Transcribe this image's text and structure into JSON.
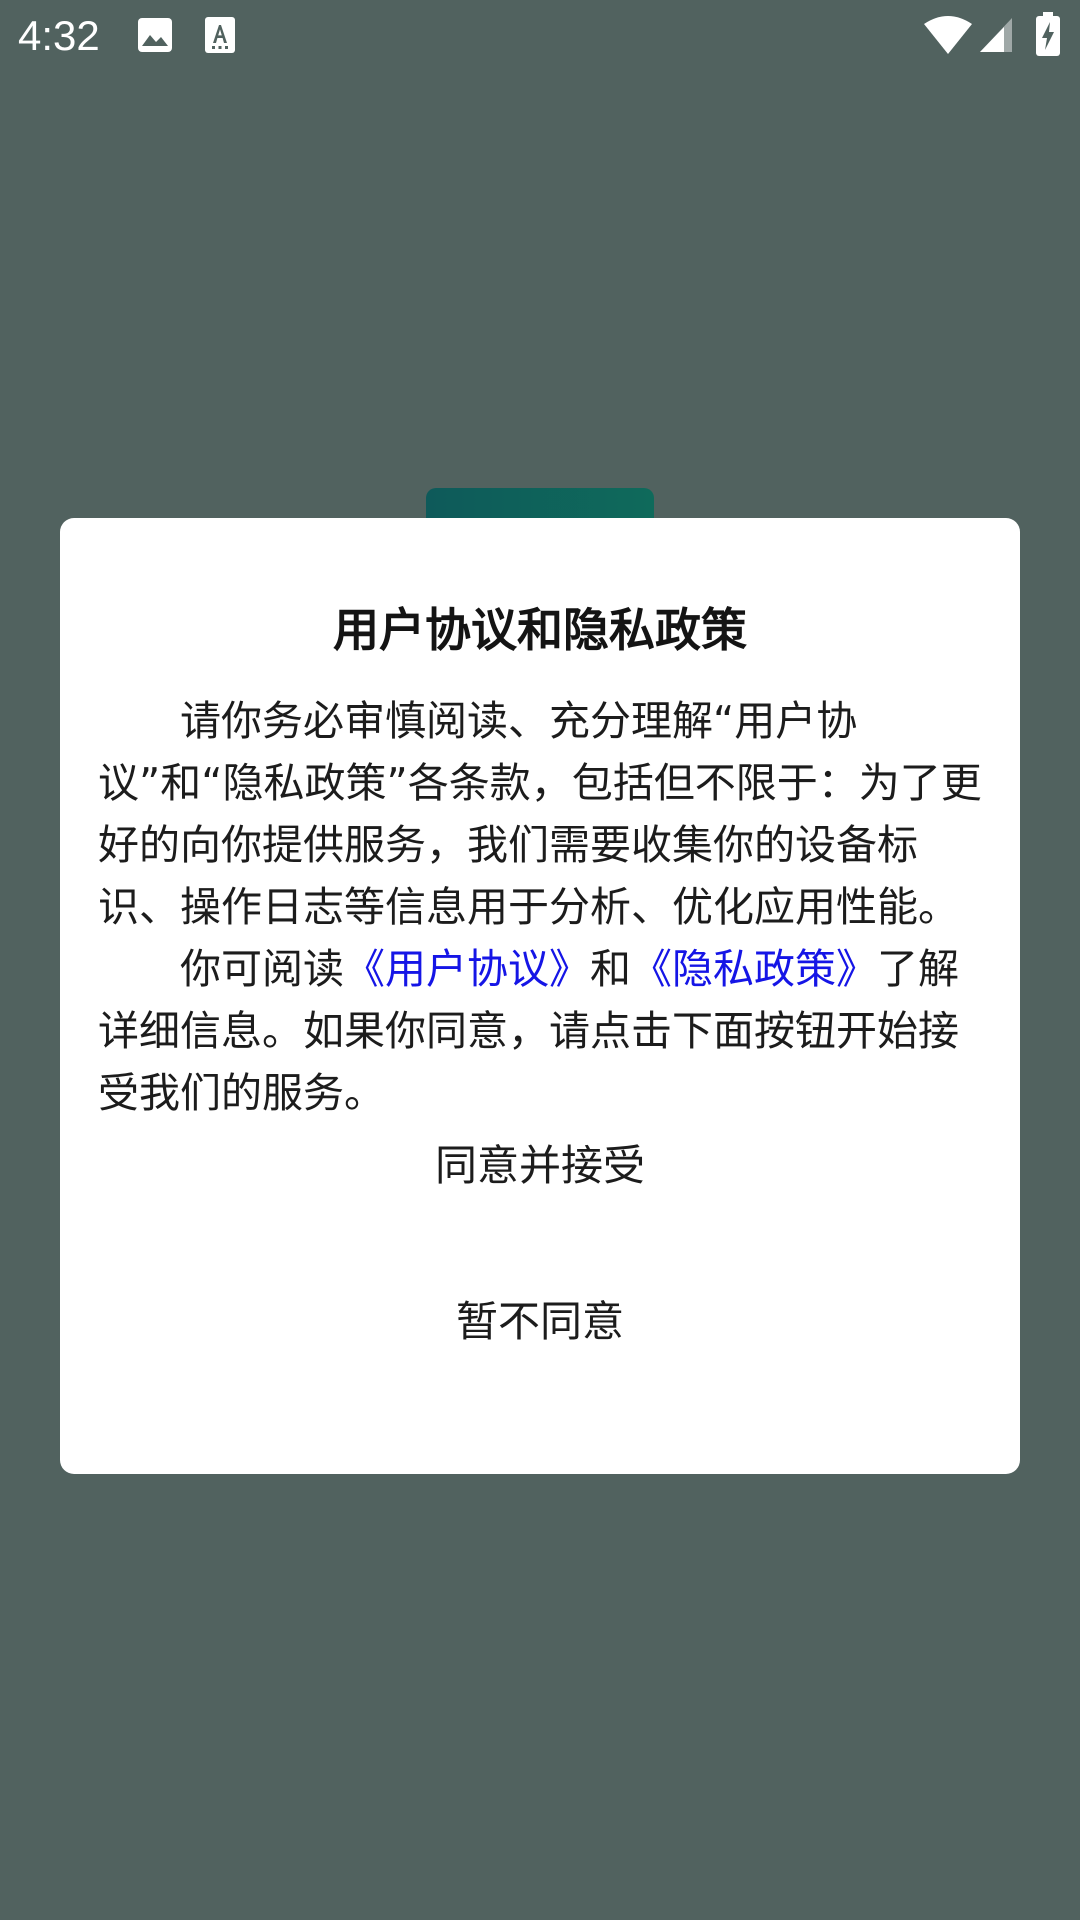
{
  "status_bar": {
    "time": "4:32",
    "icons": [
      "image-icon",
      "text-recognition-icon",
      "wifi-icon",
      "signal-icon",
      "battery-charging-icon"
    ]
  },
  "dialog": {
    "title": "用户协议和隐私政策",
    "paragraph1": "请你务必审慎阅读、充分理解“用户协议”和“隐私政策”各条款，包括但不限于：为了更好的向你提供服务，我们需要收集你的设备标识、操作日志等信息用于分析、优化应用性能。",
    "paragraph2_prefix": "你可阅读",
    "user_agreement_link": "《用户协议》",
    "paragraph2_and": "和",
    "privacy_policy_link": "《隐私政策》",
    "paragraph2_suffix": "了解详细信息。如果你同意，请点击下面按钮开始接受我们的服务。",
    "agree_button": "同意并接受",
    "decline_button": "暂不同意"
  },
  "colors": {
    "scrim_background": "#51625f",
    "link": "#1515e6",
    "dialog_background": "#ffffff",
    "background_card": "#0f6a5b"
  }
}
